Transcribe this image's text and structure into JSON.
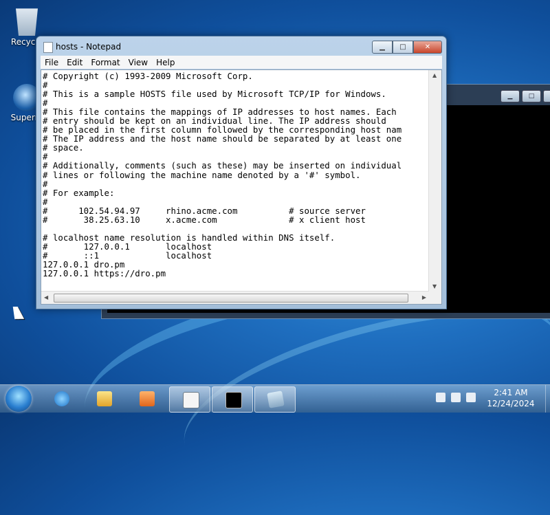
{
  "desktop": {
    "icons": [
      {
        "label": "Recycle",
        "icon": "recycle-bin-icon"
      },
      {
        "label": "Superm",
        "icon": "globe-shortcut-icon"
      }
    ]
  },
  "notepad": {
    "title": "hosts - Notepad",
    "menu": [
      "File",
      "Edit",
      "Format",
      "View",
      "Help"
    ],
    "lines": [
      "# Copyright (c) 1993-2009 Microsoft Corp.",
      "#",
      "# This is a sample HOSTS file used by Microsoft TCP/IP for Windows.",
      "#",
      "# This file contains the mappings of IP addresses to host names. Each",
      "# entry should be kept on an individual line. The IP address should",
      "# be placed in the first column followed by the corresponding host nam",
      "# The IP address and the host name should be separated by at least one",
      "# space.",
      "#",
      "# Additionally, comments (such as these) may be inserted on individual",
      "# lines or following the machine name denoted by a '#' symbol.",
      "#",
      "# For example:",
      "#",
      "#      102.54.94.97     rhino.acme.com          # source server",
      "#       38.25.63.10     x.acme.com              # x client host",
      "",
      "# localhost name resolution is handled within DNS itself.",
      "#       127.0.0.1       localhost",
      "#       ::1             localhost",
      "127.0.0.1 dro.pm",
      "127.0.0.1 https://dro.pm"
    ]
  },
  "console": {
    "icon": "cmd-window-icon"
  },
  "taskbar": {
    "clock_time": "2:41 AM",
    "clock_date": "12/24/2024",
    "buttons": [
      {
        "name": "internet-explorer",
        "icon": "internet-explorer-icon"
      },
      {
        "name": "windows-explorer",
        "icon": "folder-icon"
      },
      {
        "name": "media-player",
        "icon": "media-player-icon"
      },
      {
        "name": "notepad",
        "icon": "notepad-icon"
      },
      {
        "name": "command-prompt",
        "icon": "cmd-icon"
      },
      {
        "name": "other-app",
        "icon": "app-icon"
      }
    ]
  }
}
